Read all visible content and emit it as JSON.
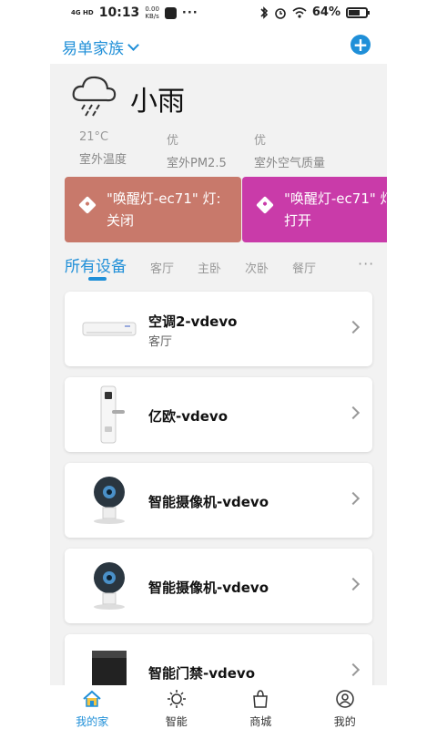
{
  "status_bar": {
    "network": "4G HD",
    "time": "10:13",
    "speed_value": "0.00",
    "speed_unit": "KB/s",
    "more": "···",
    "battery": "64%",
    "battery_level": 0.64
  },
  "header": {
    "family_name": "易单家族",
    "add_icon": "plus-circle-icon"
  },
  "weather": {
    "condition": "小雨",
    "icon": "rain-cloud-icon",
    "stats": [
      {
        "value": "21°C",
        "label": "室外温度"
      },
      {
        "value": "优",
        "label": "室外PM2.5"
      },
      {
        "value": "优",
        "label": "室外空气质量"
      }
    ]
  },
  "scenes": [
    {
      "text": "\"唤醒灯-ec71\" 灯:",
      "text2": "关闭",
      "color": "#c8796b"
    },
    {
      "text": "\"唤醒灯-ec71\" 灯",
      "text2": "打开",
      "color": "#c93ba9"
    }
  ],
  "tabs": [
    "所有设备",
    "客厅",
    "主卧",
    "次卧",
    "餐厅"
  ],
  "tabs_more": "···",
  "devices": [
    {
      "name": "空调2-vdevo",
      "room": "客厅",
      "icon": "air-conditioner-icon"
    },
    {
      "name": "亿欧-vdevo",
      "room": "",
      "icon": "door-lock-icon"
    },
    {
      "name": "智能摄像机-vdevo",
      "room": "",
      "icon": "camera-icon"
    },
    {
      "name": "智能摄像机-vdevo",
      "room": "",
      "icon": "camera-icon"
    },
    {
      "name": "智能门禁-vdevo",
      "room": "",
      "icon": "access-control-icon"
    }
  ],
  "bottom_nav": [
    {
      "label": "我的家",
      "icon": "home-icon",
      "active": true
    },
    {
      "label": "智能",
      "icon": "sun-icon",
      "active": false
    },
    {
      "label": "商城",
      "icon": "shopping-bag-icon",
      "active": false
    },
    {
      "label": "我的",
      "icon": "user-icon",
      "active": false
    }
  ],
  "colors": {
    "accent": "#1f8fd8",
    "background": "#f2f2f2"
  }
}
